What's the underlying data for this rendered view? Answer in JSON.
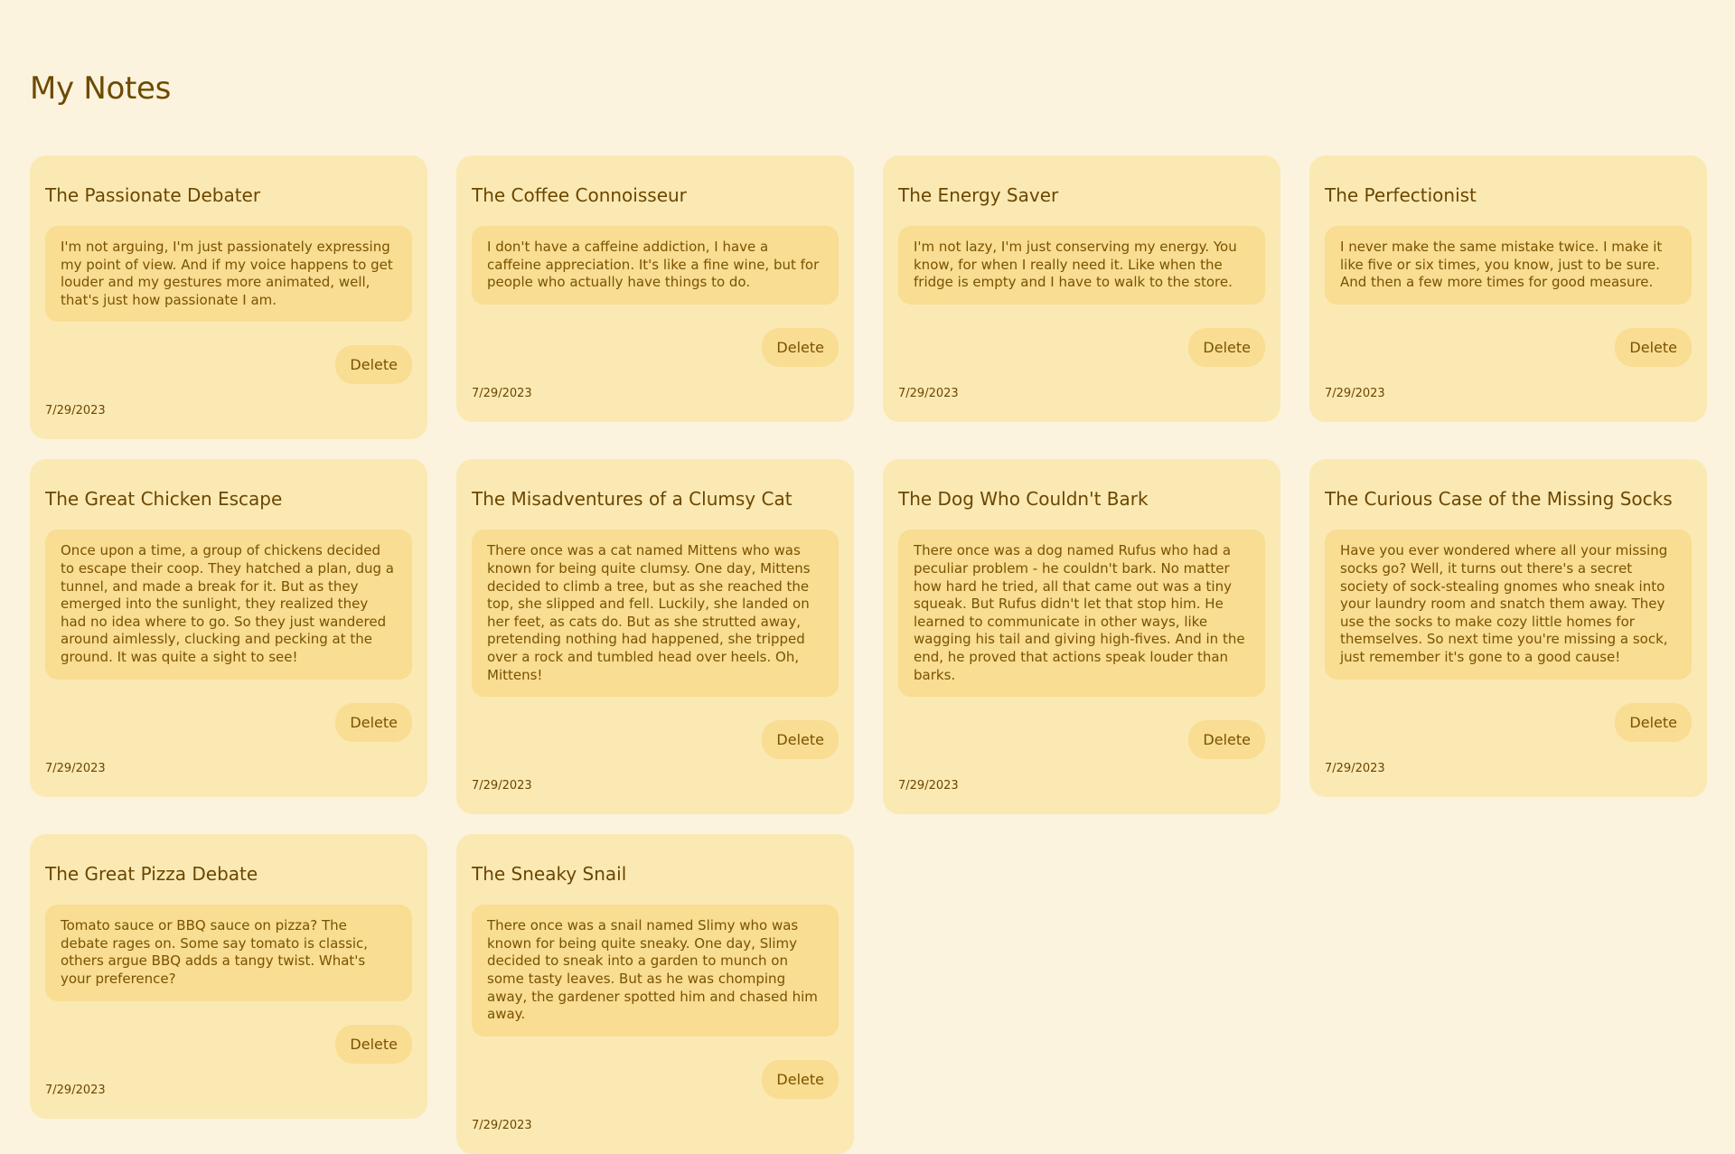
{
  "page": {
    "title": "My Notes"
  },
  "notes": [
    {
      "title": "The Passionate Debater",
      "body": "I'm not arguing, I'm just passionately expressing my point of view. And if my voice happens to get louder and my gestures more animated, well, that's just how passionate I am.",
      "delete_label": "Delete",
      "date": "7/29/2023"
    },
    {
      "title": "The Coffee Connoisseur",
      "body": "I don't have a caffeine addiction, I have a caffeine appreciation. It's like a fine wine, but for people who actually have things to do.",
      "delete_label": "Delete",
      "date": "7/29/2023"
    },
    {
      "title": "The Energy Saver",
      "body": "I'm not lazy, I'm just conserving my energy. You know, for when I really need it. Like when the fridge is empty and I have to walk to the store.",
      "delete_label": "Delete",
      "date": "7/29/2023"
    },
    {
      "title": "The Perfectionist",
      "body": "I never make the same mistake twice. I make it like five or six times, you know, just to be sure. And then a few more times for good measure.",
      "delete_label": "Delete",
      "date": "7/29/2023"
    },
    {
      "title": "The Great Chicken Escape",
      "body": "Once upon a time, a group of chickens decided to escape their coop. They hatched a plan, dug a tunnel, and made a break for it. But as they emerged into the sunlight, they realized they had no idea where to go. So they just wandered around aimlessly, clucking and pecking at the ground. It was quite a sight to see!",
      "delete_label": "Delete",
      "date": "7/29/2023"
    },
    {
      "title": "The Misadventures of a Clumsy Cat",
      "body": "There once was a cat named Mittens who was known for being quite clumsy. One day, Mittens decided to climb a tree, but as she reached the top, she slipped and fell. Luckily, she landed on her feet, as cats do. But as she strutted away, pretending nothing had happened, she tripped over a rock and tumbled head over heels. Oh, Mittens!",
      "delete_label": "Delete",
      "date": "7/29/2023"
    },
    {
      "title": "The Dog Who Couldn't Bark",
      "body": "There once was a dog named Rufus who had a peculiar problem - he couldn't bark. No matter how hard he tried, all that came out was a tiny squeak. But Rufus didn't let that stop him. He learned to communicate in other ways, like wagging his tail and giving high-fives. And in the end, he proved that actions speak louder than barks.",
      "delete_label": "Delete",
      "date": "7/29/2023"
    },
    {
      "title": "The Curious Case of the Missing Socks",
      "body": "Have you ever wondered where all your missing socks go? Well, it turns out there's a secret society of sock-stealing gnomes who sneak into your laundry room and snatch them away. They use the socks to make cozy little homes for themselves. So next time you're missing a sock, just remember it's gone to a good cause!",
      "delete_label": "Delete",
      "date": "7/29/2023"
    },
    {
      "title": "The Great Pizza Debate",
      "body": "Tomato sauce or BBQ sauce on pizza? The debate rages on. Some say tomato is classic, others argue BBQ adds a tangy twist. What's your preference?",
      "delete_label": "Delete",
      "date": "7/29/2023"
    },
    {
      "title": "The Sneaky Snail",
      "body": "There once was a snail named Slimy who was known for being quite sneaky. One day, Slimy decided to sneak into a garden to munch on some tasty leaves. But as he was chomping away, the gardener spotted him and chased him away.",
      "delete_label": "Delete",
      "date": "7/29/2023"
    }
  ]
}
